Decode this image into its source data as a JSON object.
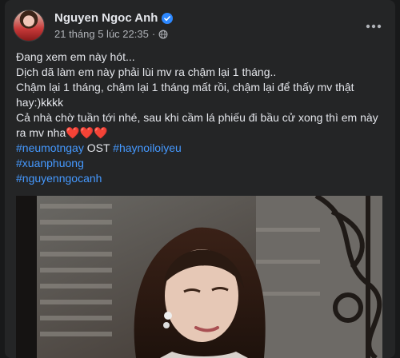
{
  "post": {
    "author_name": "Nguyen Ngoc Anh",
    "timestamp": "21 tháng 5 lúc 22:35",
    "separator": "·",
    "privacy_icon": "globe-icon",
    "more_icon": "more-horizontal-icon",
    "verified_icon": "verified-badge-icon",
    "lines": {
      "l1": "Đang xem em này hót...",
      "l2": "Dịch dã làm em này phải lùi mv ra chậm lại 1 tháng..",
      "l3": "Chậm lại 1 tháng, chậm lại 1 tháng mất rồi, chậm lại để thấy mv thật hay:)kkkk",
      "l4": "Cả nhà chờ tuần tới nhé, sau khi cầm lá phiếu đi bầu cử xong thì em này ra mv nha",
      "l4_hearts": "❤️❤️❤️",
      "tag1": "#neumotngay",
      "ost": " OST ",
      "tag2": "#haynoiloiyeu",
      "tag3": "#xuanphuong",
      "tag4": "#nguyenngocanh"
    }
  },
  "colors": {
    "background": "#18191a",
    "card": "#242526",
    "text_primary": "#e4e6eb",
    "text_secondary": "#b0b3b8",
    "hashtag": "#4599ff",
    "verified": "#2d88ff",
    "heart": "#e41e3f"
  }
}
